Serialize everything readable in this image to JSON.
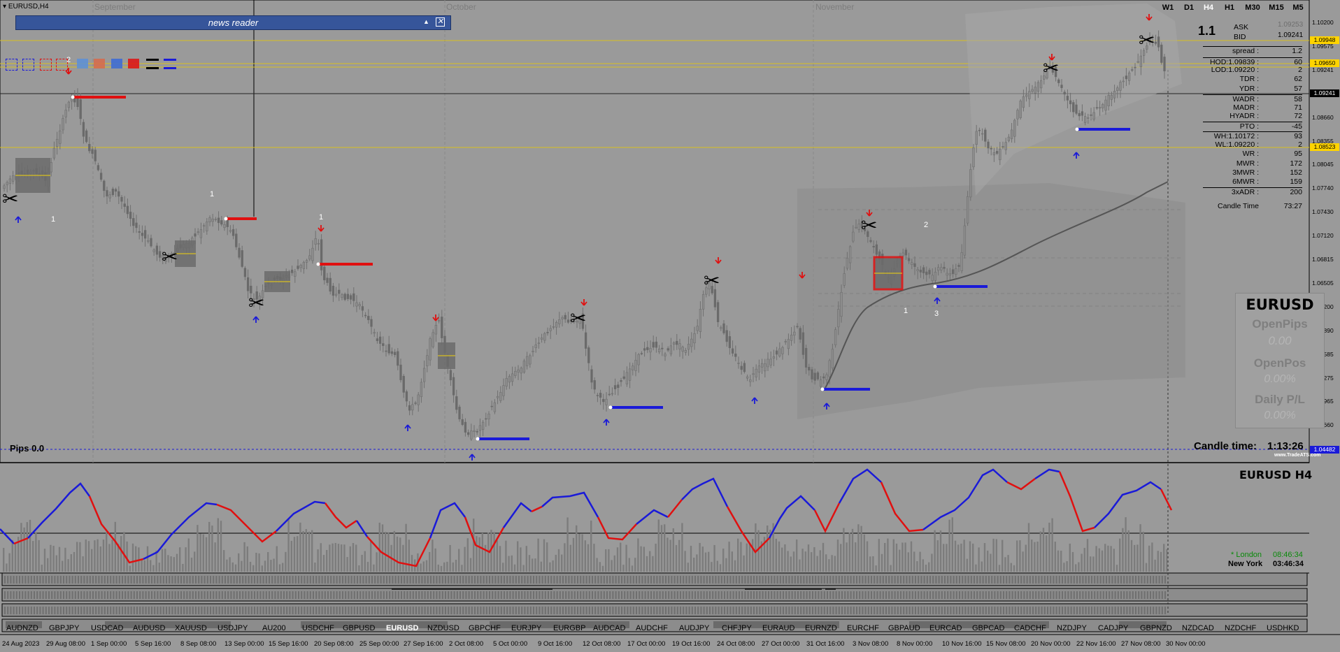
{
  "chart": {
    "title": "EURUSD,H4",
    "months": [
      "September",
      "October",
      "November"
    ],
    "timeframes": [
      {
        "label": "W1",
        "active": false
      },
      {
        "label": "D1",
        "active": false
      },
      {
        "label": "H4",
        "active": true
      },
      {
        "label": "H1",
        "active": false
      },
      {
        "label": "M30",
        "active": false
      },
      {
        "label": "M15",
        "active": false
      },
      {
        "label": "M5",
        "active": false
      }
    ],
    "price_axis": [
      "1.10200",
      "1.09575",
      "1.09241",
      "1.08970",
      "1.08660",
      "1.08355",
      "1.08045",
      "1.07740",
      "1.07430",
      "1.07120",
      "1.06815",
      "1.06505",
      "1.06200",
      "1.05890",
      "1.05585",
      "1.05275",
      "1.04965",
      "1.04660",
      "1.04350"
    ],
    "price_tags": [
      {
        "value": "1.09948",
        "bg": "#ffd400",
        "fg": "#000000"
      },
      {
        "value": "1.09650",
        "bg": "#ffd400",
        "fg": "#000000"
      },
      {
        "value": "1.09241",
        "bg": "#000000",
        "fg": "#ffffff"
      },
      {
        "value": "1.08523",
        "bg": "#ffd400",
        "fg": "#000000"
      },
      {
        "value": "1.04482",
        "bg": "#1a1ad8",
        "fg": "#ffffff"
      }
    ],
    "pips_label": "Pips 0.0",
    "candle_time_label": "Candle time:",
    "candle_time_value": "1:13:26",
    "watermark": "www.TradeATS.com",
    "wave_labels": [
      "2",
      "1",
      "1",
      "1",
      "2",
      "1",
      "3"
    ],
    "colors": {
      "up_arrow": "#1a1ad8",
      "down_arrow": "#e01010",
      "level": "#d8c020",
      "support": "#1a1ad8",
      "resistance": "#e01010"
    }
  },
  "news_reader": {
    "title": "news reader",
    "collapse_icon": "triangle-up-icon",
    "close_icon": "close-icon"
  },
  "info_panel": {
    "big": "1.1",
    "ask_label": "ASK",
    "ask_value": "1.09253",
    "bid_label": "BID",
    "bid_value": "1.09241",
    "rows": [
      {
        "label": "spread :",
        "value": "1.2",
        "sep": true
      },
      {
        "label": "HOD:1.09839 :",
        "value": "60",
        "sep": true
      },
      {
        "label": "LOD:1.09220 :",
        "value": "2",
        "sep": false
      },
      {
        "label": "TDR :",
        "value": "62",
        "sep": false
      },
      {
        "label": "YDR :",
        "value": "57",
        "sep": false
      },
      {
        "label": "WADR :",
        "value": "58",
        "sep": true
      },
      {
        "label": "MADR :",
        "value": "71",
        "sep": false
      },
      {
        "label": "HYADR :",
        "value": "72",
        "sep": false
      },
      {
        "label": "PTO :",
        "value": "-45",
        "sep": true
      },
      {
        "label": "WH:1.10172 :",
        "value": "93",
        "sep": true
      },
      {
        "label": "WL:1.09220 :",
        "value": "2",
        "sep": false
      },
      {
        "label": "WR :",
        "value": "95",
        "sep": false
      },
      {
        "label": "MWR :",
        "value": "172",
        "sep": false
      },
      {
        "label": "3MWR :",
        "value": "152",
        "sep": false
      },
      {
        "label": "6MWR :",
        "value": "159",
        "sep": false
      },
      {
        "label": "3xADR :",
        "value": "200",
        "sep": true
      },
      {
        "label": "Candle Time",
        "value": "73:27",
        "sep": false
      }
    ]
  },
  "pl_panel": {
    "symbol": "EURUSD",
    "open_pips_label": "OpenPips",
    "open_pips_value": "0.00",
    "open_pos_label": "OpenPos",
    "open_pos_value": "0.00%",
    "daily_pl_label": "Daily P/L",
    "daily_pl_value": "0.00%"
  },
  "indicator": {
    "title": "EURUSD  H4",
    "london_label": "* London",
    "london_time": "08:46:34",
    "ny_label": "New York",
    "ny_time": "03:46:34",
    "up_color": "#1a1ad8",
    "down_color": "#e01010"
  },
  "symbols": [
    {
      "label": "AUDNZD",
      "active": false
    },
    {
      "label": "GBPJPY",
      "active": false
    },
    {
      "label": "USDCAD",
      "active": false
    },
    {
      "label": "AUDUSD",
      "active": false
    },
    {
      "label": "XAUUSD",
      "active": false
    },
    {
      "label": "USDJPY",
      "active": false
    },
    {
      "label": "AU200",
      "active": false
    },
    {
      "label": "USDCHF",
      "active": false
    },
    {
      "label": "GBPUSD",
      "active": false
    },
    {
      "label": "EURUSD",
      "active": true
    },
    {
      "label": "NZDUSD",
      "active": false
    },
    {
      "label": "GBPCHF",
      "active": false
    },
    {
      "label": "EURJPY",
      "active": false
    },
    {
      "label": "EURGBP",
      "active": false
    },
    {
      "label": "AUDCAD",
      "active": false
    },
    {
      "label": "AUDCHF",
      "active": false
    },
    {
      "label": "AUDJPY",
      "active": false
    },
    {
      "label": "CHFJPY",
      "active": false
    },
    {
      "label": "EURAUD",
      "active": false
    },
    {
      "label": "EURNZD",
      "active": false
    },
    {
      "label": "EURCHF",
      "active": false
    },
    {
      "label": "GBPAUD",
      "active": false
    },
    {
      "label": "EURCAD",
      "active": false
    },
    {
      "label": "GBPCAD",
      "active": false
    },
    {
      "label": "CADCHF",
      "active": false
    },
    {
      "label": "NZDJPY",
      "active": false
    },
    {
      "label": "CADJPY",
      "active": false
    },
    {
      "label": "GBPNZD",
      "active": false
    },
    {
      "label": "NZDCAD",
      "active": false
    },
    {
      "label": "NZDCHF",
      "active": false
    },
    {
      "label": "USDHKD",
      "active": false
    }
  ],
  "dates": [
    "24 Aug 2023",
    "29 Aug 08:00",
    "1 Sep 00:00",
    "5 Sep 16:00",
    "8 Sep 08:00",
    "13 Sep 00:00",
    "15 Sep 16:00",
    "20 Sep 08:00",
    "25 Sep 00:00",
    "27 Sep 16:00",
    "2 Oct 08:00",
    "5 Oct 00:00",
    "9 Oct 16:00",
    "12 Oct 08:00",
    "17 Oct 00:00",
    "19 Oct 16:00",
    "24 Oct 08:00",
    "27 Oct 00:00",
    "31 Oct 16:00",
    "3 Nov 08:00",
    "8 Nov 00:00",
    "10 Nov 16:00",
    "15 Nov 08:00",
    "20 Nov 00:00",
    "22 Nov 16:00",
    "27 Nov 08:00",
    "30 Nov 00:00"
  ],
  "color_boxes": [
    {
      "color": "#1a1ad8",
      "style": "dashed"
    },
    {
      "color": "#1a1ad8",
      "style": "dashed"
    },
    {
      "color": "#e01010",
      "style": "dashed"
    },
    {
      "color": "#e01010",
      "style": "dashed"
    },
    {
      "color": "#5b8fd8",
      "style": "solid"
    },
    {
      "color": "#d86a4a",
      "style": "solid"
    },
    {
      "color": "#3a6ad8",
      "style": "solid"
    },
    {
      "color": "#e01010",
      "style": "solid"
    },
    {
      "color": "#000000",
      "style": "solid"
    },
    {
      "color": "#1a1ad8",
      "style": "solid"
    }
  ]
}
